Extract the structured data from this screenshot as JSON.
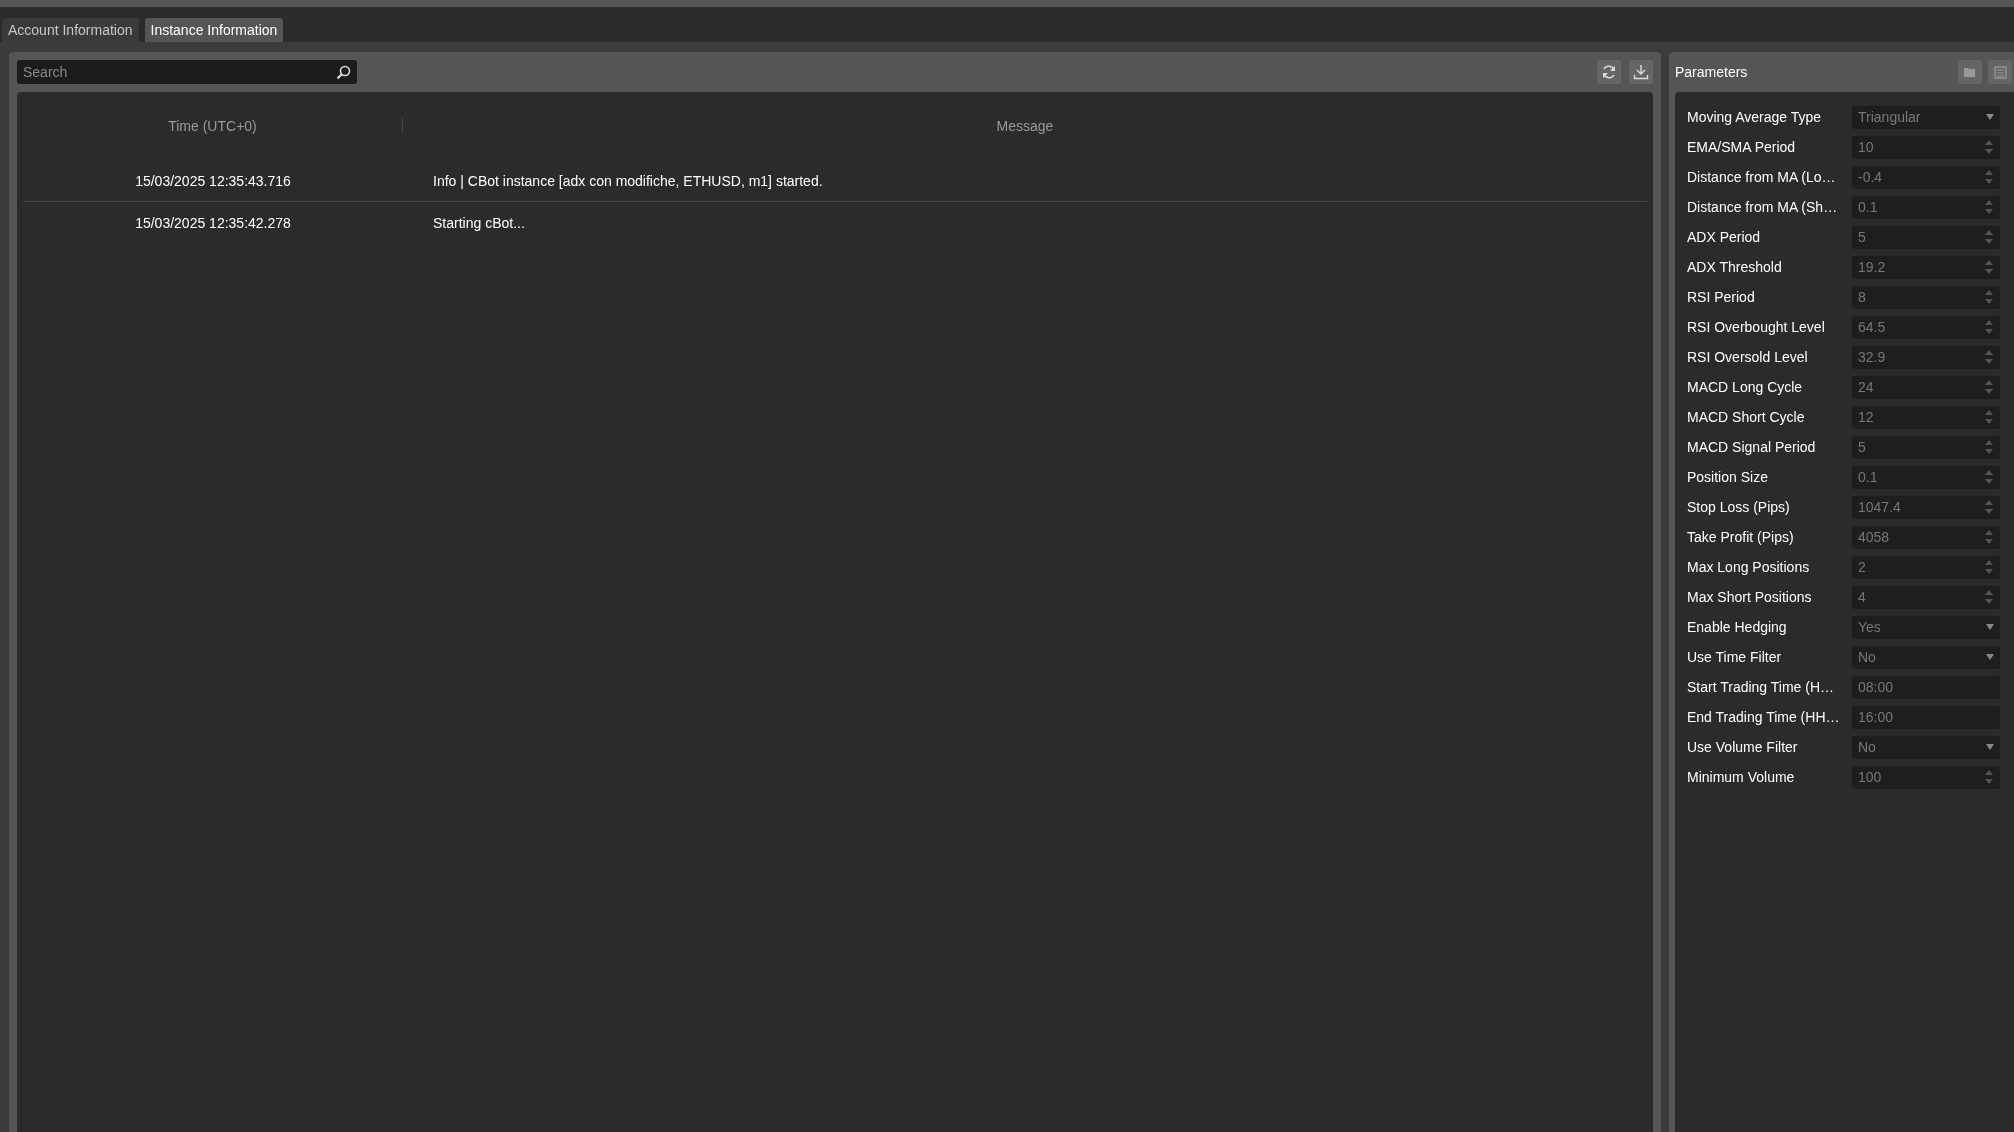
{
  "tabs": [
    {
      "label": "Account Information",
      "selected": false
    },
    {
      "label": "Instance Information",
      "selected": true
    }
  ],
  "search": {
    "placeholder": "Search"
  },
  "log": {
    "columns": [
      "Time (UTC+0)",
      "Message"
    ],
    "rows": [
      {
        "time": "15/03/2025 12:35:43.716",
        "message": "Info | CBot instance [adx con modifiche, ETHUSD, m1] started."
      },
      {
        "time": "15/03/2025 12:35:42.278",
        "message": "Starting cBot..."
      }
    ]
  },
  "parameters": {
    "title": "Parameters",
    "items": [
      {
        "label": "Moving Average Type",
        "value": "Triangular",
        "kind": "select"
      },
      {
        "label": "EMA/SMA Period",
        "value": "10",
        "kind": "number"
      },
      {
        "label": "Distance from MA (Lo…",
        "value": "-0.4",
        "kind": "number"
      },
      {
        "label": "Distance from MA (Sh…",
        "value": "0.1",
        "kind": "number"
      },
      {
        "label": "ADX Period",
        "value": "5",
        "kind": "number"
      },
      {
        "label": "ADX Threshold",
        "value": "19.2",
        "kind": "number"
      },
      {
        "label": "RSI Period",
        "value": "8",
        "kind": "number"
      },
      {
        "label": "RSI Overbought Level",
        "value": "64.5",
        "kind": "number"
      },
      {
        "label": "RSI Oversold Level",
        "value": "32.9",
        "kind": "number"
      },
      {
        "label": "MACD Long Cycle",
        "value": "24",
        "kind": "number"
      },
      {
        "label": "MACD Short Cycle",
        "value": "12",
        "kind": "number"
      },
      {
        "label": "MACD Signal Period",
        "value": "5",
        "kind": "number"
      },
      {
        "label": "Position Size",
        "value": "0.1",
        "kind": "number"
      },
      {
        "label": "Stop Loss (Pips)",
        "value": "1047.4",
        "kind": "number"
      },
      {
        "label": "Take Profit (Pips)",
        "value": "4058",
        "kind": "number"
      },
      {
        "label": "Max Long Positions",
        "value": "2",
        "kind": "number"
      },
      {
        "label": "Max Short Positions",
        "value": "4",
        "kind": "number"
      },
      {
        "label": "Enable Hedging",
        "value": "Yes",
        "kind": "select"
      },
      {
        "label": "Use Time Filter",
        "value": "No",
        "kind": "select"
      },
      {
        "label": "Start Trading Time (H…",
        "value": "08:00",
        "kind": "text"
      },
      {
        "label": "End Trading Time (HH…",
        "value": "16:00",
        "kind": "text"
      },
      {
        "label": "Use Volume Filter",
        "value": "No",
        "kind": "select"
      },
      {
        "label": "Minimum Volume",
        "value": "100",
        "kind": "number"
      }
    ]
  }
}
